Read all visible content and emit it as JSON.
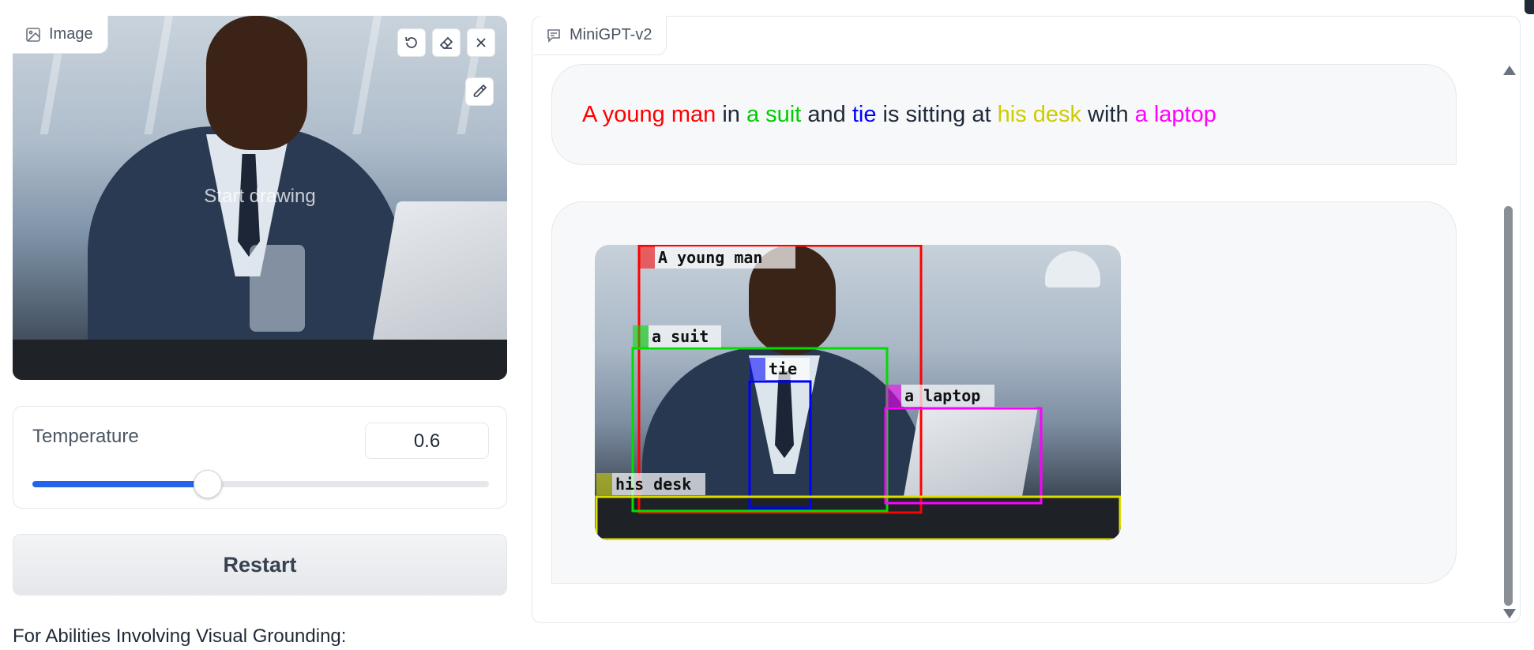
{
  "image_input": {
    "tab_label": "Image",
    "placeholder": "Start drawing",
    "tool_undo": "undo-icon",
    "tool_erase": "eraser-icon",
    "tool_close": "close-icon",
    "tool_brush": "brush-icon"
  },
  "temperature": {
    "label": "Temperature",
    "value": "0.6",
    "fraction": 0.6
  },
  "restart_label": "Restart",
  "footnote": "For Abilities Involving Visual Grounding:",
  "chat": {
    "tab_label": "MiniGPT-v2",
    "user_message": [
      {
        "text": "A young man",
        "color": "#ff0000"
      },
      {
        "text": " in ",
        "color": "#1f2937"
      },
      {
        "text": "a suit",
        "color": "#00cc00"
      },
      {
        "text": " and ",
        "color": "#1f2937"
      },
      {
        "text": "tie",
        "color": "#0000ff"
      },
      {
        "text": " is sitting at ",
        "color": "#1f2937"
      },
      {
        "text": "his desk",
        "color": "#cccc00"
      },
      {
        "text": " with ",
        "color": "#1f2937"
      },
      {
        "text": "a laptop",
        "color": "#ff00ff"
      }
    ],
    "grounded_boxes": [
      {
        "label": "A young man",
        "color": "#ff0000"
      },
      {
        "label": "a suit",
        "color": "#00dd00"
      },
      {
        "label": "tie",
        "color": "#0000ff"
      },
      {
        "label": "a laptop",
        "color": "#ff00ff"
      },
      {
        "label": "his desk",
        "color": "#dddd00"
      }
    ]
  }
}
